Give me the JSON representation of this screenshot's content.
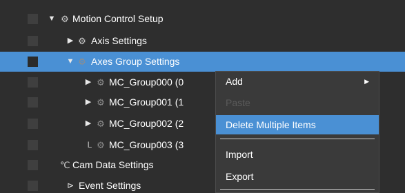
{
  "tree": {
    "items": [
      {
        "label": "Motion Control Setup",
        "toggle": "▼",
        "icon": "gear-icon",
        "icon_glyph": "⚙"
      },
      {
        "label": "Axis Settings",
        "toggle": "▶",
        "icon": "gear-icon",
        "icon_glyph": "⚙"
      },
      {
        "label": "Axes Group Settings",
        "toggle": "▼",
        "icon": "multi-gear-icon",
        "icon_glyph": "⚙",
        "selected": true
      },
      {
        "label": "MC_Group000 (0",
        "toggle": "▶",
        "icon": "axes-group-icon",
        "icon_glyph": "⚙"
      },
      {
        "label": "MC_Group001 (1",
        "toggle": "▶",
        "icon": "axes-group-icon",
        "icon_glyph": "⚙"
      },
      {
        "label": "MC_Group002 (2",
        "toggle": "▶",
        "icon": "axes-group-icon",
        "icon_glyph": "⚙"
      },
      {
        "label": "MC_Group003 (3",
        "toggle": "L",
        "icon": "axes-group-icon",
        "icon_glyph": "⚙"
      },
      {
        "label": "Cam Data Settings",
        "icon": "cam-curve-icon",
        "icon_glyph": "℃"
      },
      {
        "label": "Event Settings",
        "toggle": "⊳",
        "icon": "event-flag-icon",
        "icon_glyph": ""
      }
    ]
  },
  "context_menu": {
    "items": [
      {
        "label": "Add",
        "submenu_arrow": "▶"
      },
      {
        "label": "Paste",
        "disabled": true
      },
      {
        "label": "Delete Multiple Items",
        "highlighted": true
      },
      {
        "label": "Import"
      },
      {
        "label": "Export"
      }
    ]
  },
  "colors": {
    "selection": "#4a90d4",
    "background": "#2e2e2e",
    "menu_background": "#3a3a3a"
  }
}
